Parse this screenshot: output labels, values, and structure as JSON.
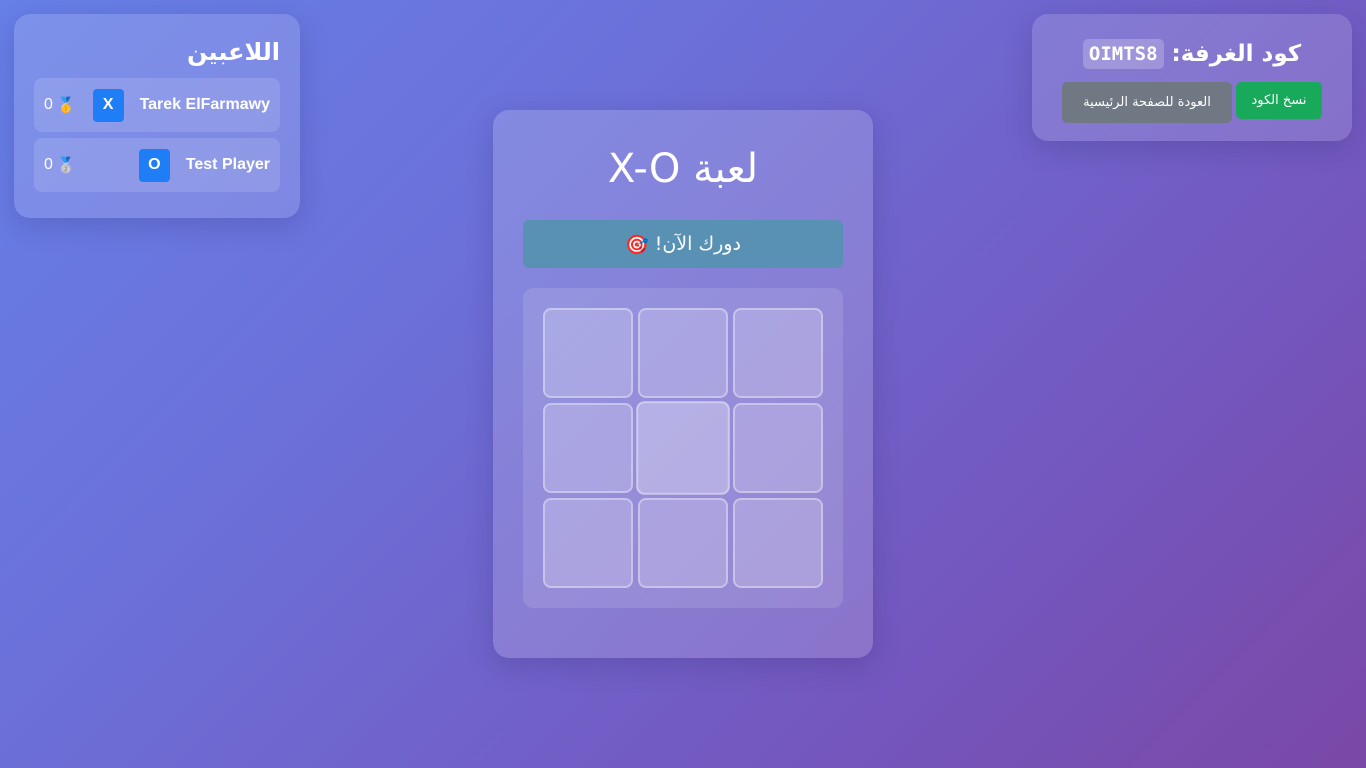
{
  "players_panel": {
    "title": "اللاعبين",
    "players": [
      {
        "name": "Tarek ElFarmawy",
        "symbol": "X",
        "score": "0",
        "medal": "🥇"
      },
      {
        "name": "Test Player",
        "symbol": "O",
        "score": "0",
        "medal": "🥈"
      }
    ]
  },
  "room": {
    "label": "كود الغرفة:",
    "code": "OIMTS8",
    "copy_button": "نسخ الكود",
    "home_button": "العودة للصفحة الرئيسية"
  },
  "game": {
    "title": "لعبة X-O",
    "turn_icon": "🎯",
    "turn_text": "دورك الآن!",
    "board": [
      "",
      "",
      "",
      "",
      "",
      "",
      "",
      "",
      ""
    ]
  },
  "colors": {
    "player_badge": "#1f7ef5",
    "copy_button": "#19a95a",
    "home_button": "#707883",
    "turn_banner": "#5891b4"
  }
}
